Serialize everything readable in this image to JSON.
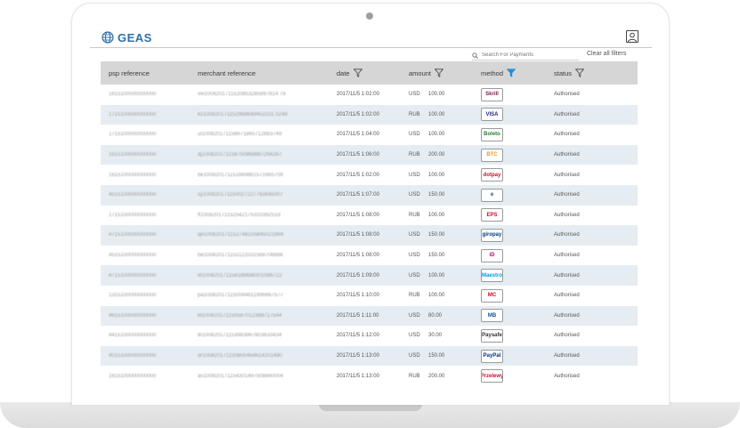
{
  "header": {
    "logo_text": "GEAS"
  },
  "search": {
    "placeholder": "Search For Payments"
  },
  "toolbar": {
    "clear_label": "Clear all filters"
  },
  "columns": [
    {
      "label": "psp reference"
    },
    {
      "label": "merchant reference"
    },
    {
      "label": "date"
    },
    {
      "label": "amount"
    },
    {
      "label": "method"
    },
    {
      "label": "status"
    }
  ],
  "colors": {
    "accent": "#2d6fa8",
    "method_filter_active": "#2a8fd6",
    "header_bg": "#d6d6d6",
    "stripe_row": "#e6edf2"
  },
  "rows": [
    {
      "psp": "1615100000000000",
      "merchant": "vw1008201711520853285897814 79",
      "date": "2017/11/5 1:02:00",
      "currency": "USD",
      "amount": "100.00",
      "method": "Skrill",
      "method_color": "#7a1a47",
      "status": "Authorised"
    },
    {
      "psp": "1715100000000000",
      "merchant": "kx100820171152968649453151 0248",
      "date": "2017/11/5 1:02:00",
      "currency": "RUB",
      "amount": "100.00",
      "method": "VISA",
      "method_color": "#1a1f71",
      "status": "Authorised"
    },
    {
      "psp": "1715100000000000",
      "merchant": "ui100820171158971865712883749",
      "date": "2017/11/5 1:04:00",
      "currency": "USD",
      "amount": "100.00",
      "method": "Boleto",
      "method_color": "#2e7d32",
      "status": "Authorised"
    },
    {
      "psp": "1615100000000000",
      "merchant": "dj100820171158750868887294287",
      "date": "2017/11/5 1:06:00",
      "currency": "RUB",
      "amount": "200.00",
      "method": "BTC",
      "method_color": "#f7931a",
      "status": "Authorised"
    },
    {
      "psp": "1615100000000000",
      "merchant": "bk100820171151669861571665709",
      "date": "2017/11/5 1:02:00",
      "currency": "USD",
      "amount": "100.00",
      "method": "dotpay",
      "method_color": "#c8102e",
      "status": "Authorised"
    },
    {
      "psp": "4515100000000000",
      "merchant": "sy100820171150027227763845007",
      "date": "2017/11/5 1:07:00",
      "currency": "USD",
      "amount": "150.00",
      "method": "e",
      "method_color": "#1a4f8b",
      "status": "Authorised"
    },
    {
      "psp": "1715100000000000",
      "merchant": "ff100820171152542175310392519",
      "date": "2017/11/5 1:08:00",
      "currency": "RUB",
      "amount": "100.00",
      "method": "EPS",
      "method_color": "#c8102e",
      "status": "Authorised"
    },
    {
      "psp": "4715100000000000",
      "merchant": "qe100820171152748105845021894",
      "date": "2017/11/5 1:08:00",
      "currency": "USD",
      "amount": "150.00",
      "method": "giropay",
      "method_color": "#003a7d",
      "status": "Authorised"
    },
    {
      "psp": "4515100000000000",
      "merchant": "be100820171151122031568706866",
      "date": "2017/11/5 1:08:00",
      "currency": "USD",
      "amount": "150.00",
      "method": "iD",
      "method_color": "#cc0066",
      "status": "Authorised"
    },
    {
      "psp": "4715100000000000",
      "merchant": "td100820171158189688301086722",
      "date": "2017/11/5 1:09:00",
      "currency": "USD",
      "amount": "100.00",
      "method": "Maestro",
      "method_color": "#0099df",
      "status": "Authorised"
    },
    {
      "psp": "1315100000000000",
      "merchant": "pa100820171150084611996667577",
      "date": "2017/11/5 1:10:00",
      "currency": "RUB",
      "amount": "100.00",
      "method": "MC",
      "method_color": "#eb001b",
      "status": "Authorised"
    },
    {
      "psp": "4615100000000000",
      "merchant": "bl100820171150587012388717544",
      "date": "2017/11/5 1:11:00",
      "currency": "USD",
      "amount": "80.00",
      "method": "MB",
      "method_color": "#1a4f8b",
      "status": "Authorised"
    },
    {
      "psp": "4415100000000000",
      "merchant": "tk100820171153983967803633434",
      "date": "2017/11/5 1:12:00",
      "currency": "USD",
      "amount": "30.00",
      "method": "Paysafe",
      "method_color": "#333333",
      "status": "Authorised"
    },
    {
      "psp": "4015100000000000",
      "merchant": "dr100820171150800454614201480",
      "date": "2017/11/5 1:13:00",
      "currency": "USD",
      "amount": "150.00",
      "method": "PayPal",
      "method_color": "#003087",
      "status": "Authorised"
    },
    {
      "psp": "1615100000000000",
      "merchant": "as100820171154301497508840004",
      "date": "2017/11/5 1:13:00",
      "currency": "RUB",
      "amount": "200.00",
      "method": "Przelewy",
      "method_color": "#c8102e",
      "status": "Authorised"
    }
  ]
}
